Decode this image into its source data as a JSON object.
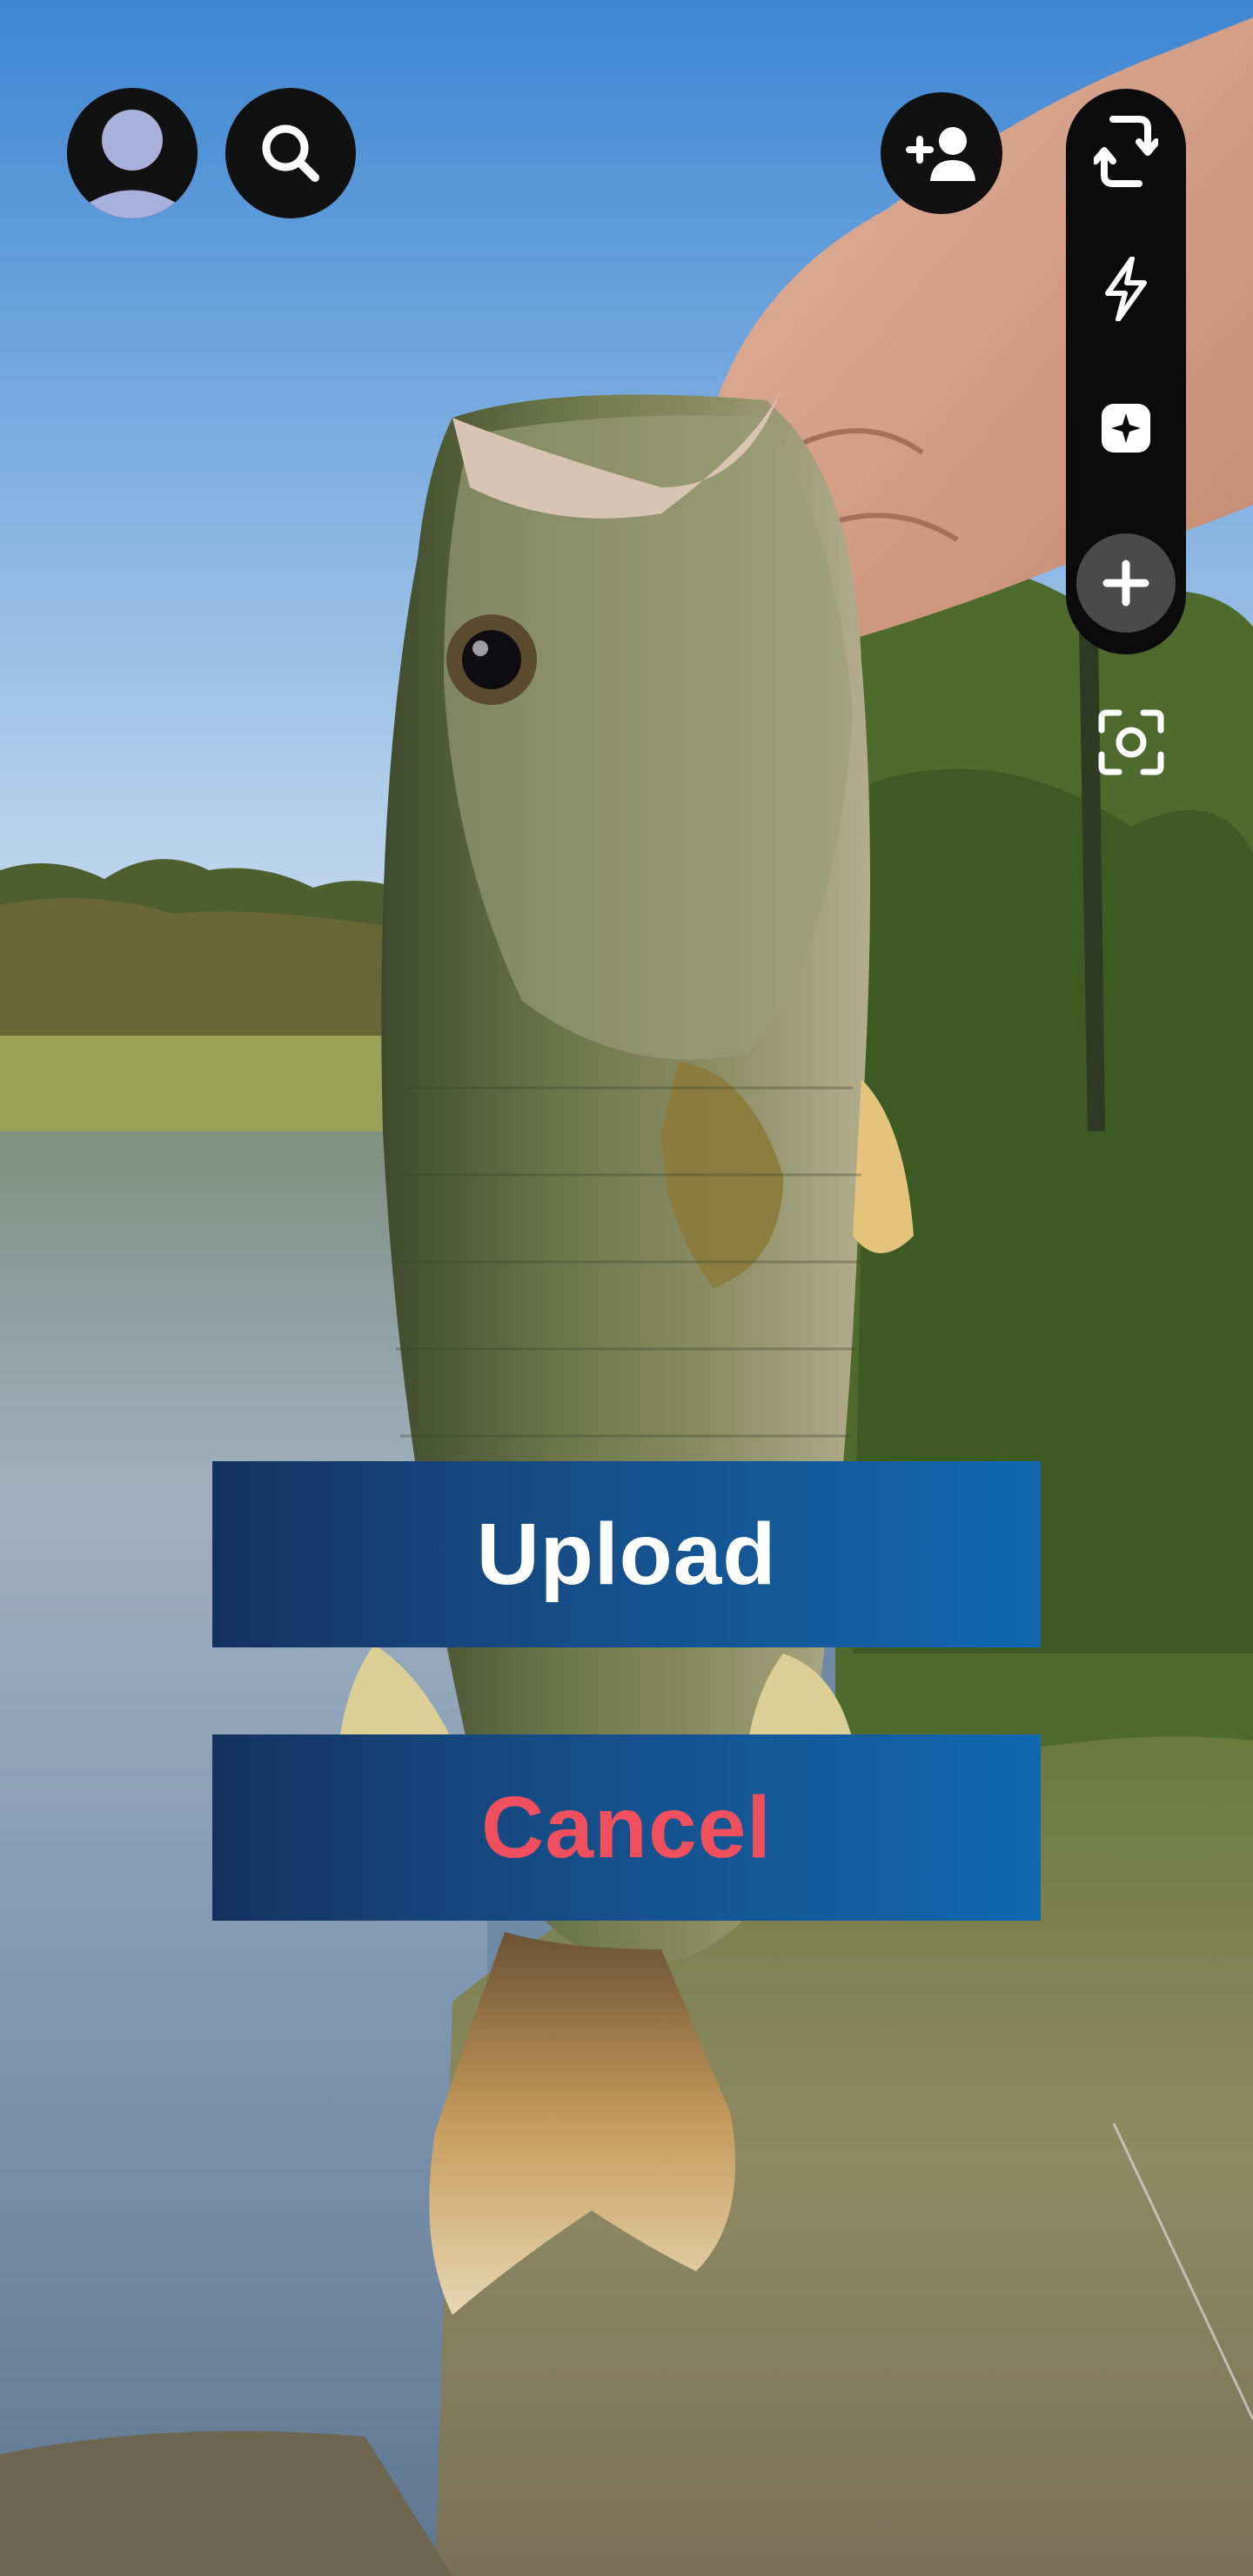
{
  "camera": {
    "photo_subject": "",
    "actions": {
      "upload_label": "Upload",
      "cancel_label": "Cancel"
    },
    "top_bar": {
      "profile_icon": "avatar-icon",
      "search_icon": "search-icon",
      "add_friend_icon": "add-friend-icon"
    },
    "toolbar": {
      "items": [
        "flip-camera-icon",
        "flash-icon",
        "lens-icon",
        "plus-icon"
      ],
      "scan_icon": "scan-icon"
    }
  },
  "colors": {
    "button_gradient_start": "#143260",
    "button_gradient_end": "#1268b0",
    "upload_text": "#ffffff",
    "cancel_text": "#f0505d",
    "toolbar_bg": "#0b0b0b"
  }
}
